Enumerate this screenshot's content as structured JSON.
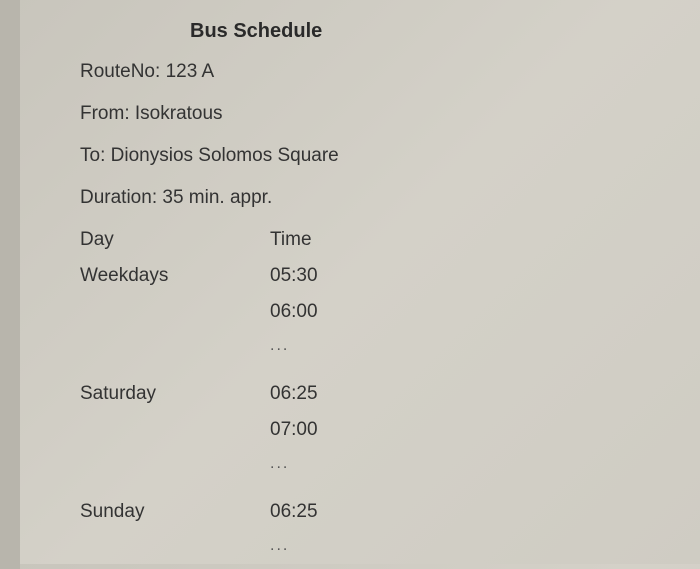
{
  "title": "Bus Schedule",
  "route": {
    "label": "RouteNo:",
    "value": "123 A"
  },
  "from": {
    "label": "From:",
    "value": "Isokratous"
  },
  "to": {
    "label": "To:",
    "value": "Dionysios Solomos Square"
  },
  "duration": {
    "label": "Duration:",
    "value": "35 min. appr."
  },
  "headers": {
    "day": "Day",
    "time": "Time"
  },
  "schedule": [
    {
      "day": "Weekdays",
      "times": [
        "05:30",
        "06:00",
        "..."
      ]
    },
    {
      "day": "Saturday",
      "times": [
        "06:25",
        "07:00",
        "..."
      ]
    },
    {
      "day": "Sunday",
      "times": [
        "06:25",
        "..."
      ]
    }
  ]
}
